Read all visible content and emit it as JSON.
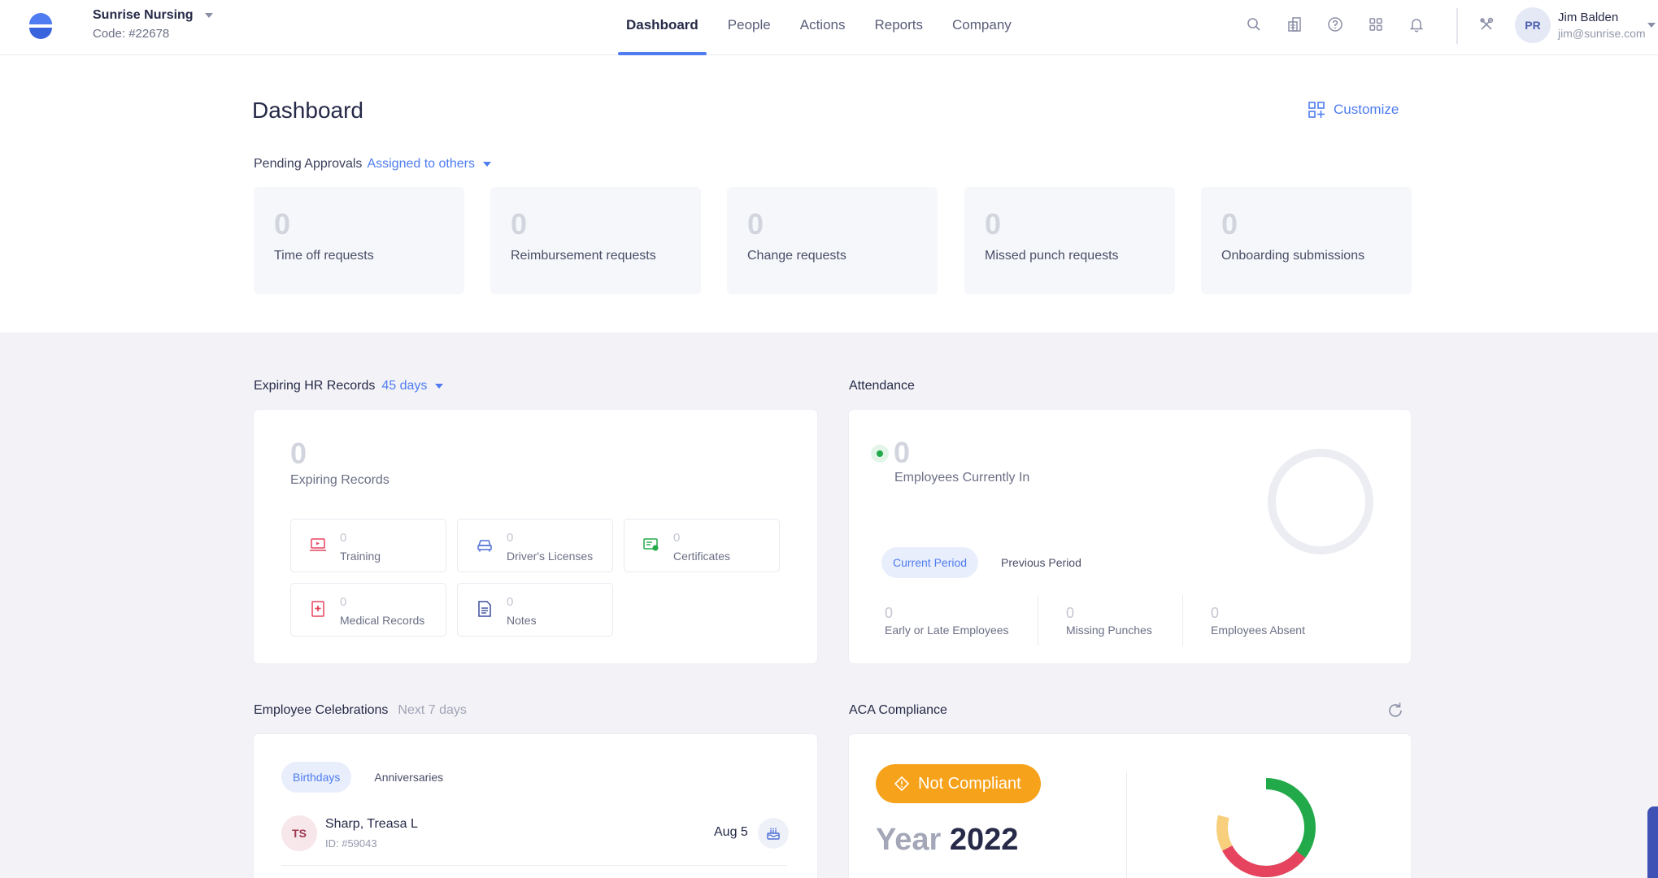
{
  "company": {
    "name": "Sunrise Nursing",
    "code": "Code: #22678"
  },
  "nav": {
    "items": [
      {
        "label": "Dashboard"
      },
      {
        "label": "People"
      },
      {
        "label": "Actions"
      },
      {
        "label": "Reports"
      },
      {
        "label": "Company"
      }
    ]
  },
  "header_icons": [
    "search-icon",
    "org-chart-icon",
    "help-icon",
    "apps-grid-icon",
    "bell-icon",
    "tools-icon"
  ],
  "user": {
    "initials": "PR",
    "name": "Jim Balden",
    "email": "jim@sunrise.com"
  },
  "dashboard": {
    "title": "Dashboard",
    "customize_label": "Customize",
    "pending": {
      "label": "Pending Approvals",
      "filter": "Assigned to others",
      "cards": [
        {
          "value": "0",
          "label": "Time off requests"
        },
        {
          "value": "0",
          "label": "Reimbursement requests"
        },
        {
          "value": "0",
          "label": "Change requests"
        },
        {
          "value": "0",
          "label": "Missed punch requests"
        },
        {
          "value": "0",
          "label": "Onboarding submissions"
        }
      ]
    }
  },
  "hr_records": {
    "title": "Expiring HR Records",
    "range": "45 days",
    "value": "0",
    "label": "Expiring Records",
    "items": [
      {
        "value": "0",
        "label": "Training",
        "icon": "training-icon"
      },
      {
        "value": "0",
        "label": "Driver's Licenses",
        "icon": "car-icon"
      },
      {
        "value": "0",
        "label": "Certificates",
        "icon": "certificate-icon"
      },
      {
        "value": "0",
        "label": "Medical Records",
        "icon": "medical-icon"
      },
      {
        "value": "0",
        "label": "Notes",
        "icon": "notes-icon"
      }
    ]
  },
  "attendance": {
    "title": "Attendance",
    "value": "0",
    "label": "Employees Currently In",
    "tabs": [
      "Current Period",
      "Previous Period"
    ],
    "stats": [
      {
        "value": "0",
        "label": "Early or Late Employees"
      },
      {
        "value": "0",
        "label": "Missing Punches"
      },
      {
        "value": "0",
        "label": "Employees Absent"
      }
    ]
  },
  "celebrations": {
    "title": "Employee Celebrations",
    "range": "Next 7 days",
    "tabs": [
      "Birthdays",
      "Anniversaries"
    ],
    "people": [
      {
        "initials": "TS",
        "name": "Sharp, Treasa L",
        "id": "ID: #59043",
        "date": "Aug 5"
      }
    ]
  },
  "aca": {
    "title": "ACA Compliance",
    "status": "Not Compliant",
    "year_label": "Year",
    "year": "2022"
  },
  "colors": {
    "accent": "#4f7cf0",
    "compliant": "#22a94a",
    "not_compliant": "#e6445e",
    "warning": "#f7a21b",
    "pending": "#f7cf7d"
  }
}
